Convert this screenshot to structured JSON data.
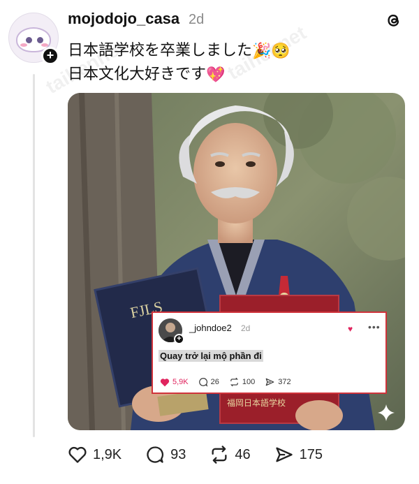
{
  "post": {
    "username": "mojodojo_casa",
    "time": "2d",
    "text_line1": "日本語学校を卒業しました",
    "text_line1_emoji": "🎉🥺",
    "text_line2": "日本文化大好きです",
    "text_line2_emoji": "💖"
  },
  "overlay_comment": {
    "username": "_johndoe2",
    "time": "2d",
    "text": "Quay trở lại mộ phần đi",
    "likes": "5,9K",
    "replies": "26",
    "reposts": "100",
    "shares": "372"
  },
  "photo": {
    "book_left_label": "FJLS",
    "book_right_label": "福岡日本語学校"
  },
  "actions": {
    "likes": "1,9K",
    "replies": "93",
    "reposts": "46",
    "shares": "175"
  },
  "watermark": "taihennet",
  "colors": {
    "like_red": "#e0245e",
    "overlay_border": "#d0333b"
  }
}
